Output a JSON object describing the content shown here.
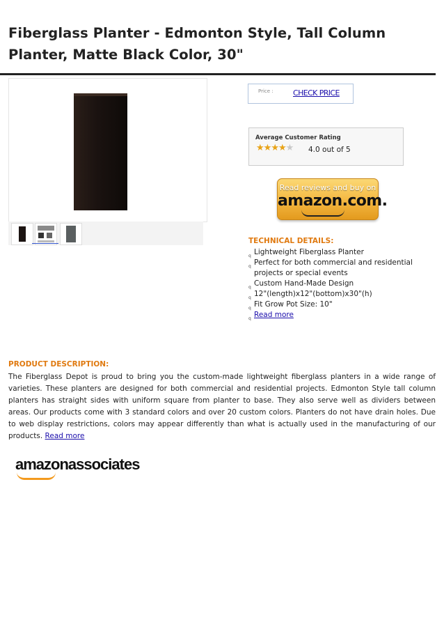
{
  "product": {
    "title_line1": "Fiberglass Planter - Edmonton Style, Tall Column",
    "title_line2": "Planter, Matte Black Color, 30\""
  },
  "price": {
    "label": "Price :",
    "link_text": "CHECK PRICE"
  },
  "rating": {
    "title": "Average Customer Rating",
    "value": 4.0,
    "max": 5,
    "text": "4.0 out of 5"
  },
  "amazon_button": {
    "top_text": "Read reviews and buy on",
    "logo_text": "amazon.com."
  },
  "technical": {
    "title": "TECHNICAL DETAILS:",
    "items": [
      "Lightweight Fiberglass Planter",
      "Perfect for both commercial and residential projects or special events",
      "Custom Hand-Made Design",
      "12\"(length)x12\"(bottom)x30\"(h)",
      "Fit Grow Pot Size: 10\""
    ],
    "read_more": "Read more"
  },
  "description": {
    "title": "PRODUCT DESCRIPTION:",
    "body": "The Fiberglass Depot is proud to bring you the custom-made lightweight fiberglass planters in a wide range of varieties. These planters are designed for both commercial and residential projects. Edmonton Style tall column planters has straight sides with uniform square from planter to base. They also serve well as dividers between areas. Our products come with 3 standard colors and over 20 custom colors. Planters do not have drain holes. Due to web display restrictions, colors may appear differently than what is actually used in the manufacturing of our products.",
    "read_more": "Read more"
  },
  "footer": {
    "associates_text": "amazonassociates"
  },
  "colors": {
    "accent_orange": "#e07a10",
    "link_blue": "#1a0dab",
    "star_gold": "#e8a317"
  }
}
